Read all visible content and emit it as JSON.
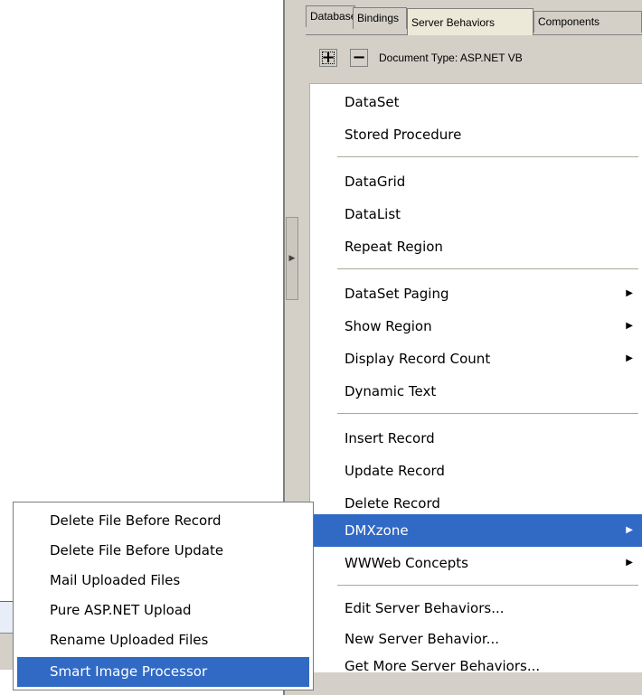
{
  "panel": {
    "tabs": [
      "Databases",
      "Bindings",
      "Server Behaviors",
      "Components"
    ],
    "active_tab": "Server Behaviors",
    "toolbar": {
      "plus_label": "+",
      "minus_label": "−",
      "document_type": "Document Type: ASP.NET VB"
    }
  },
  "menu": {
    "items": [
      {
        "label": "DataSet"
      },
      {
        "label": "Stored Procedure"
      },
      {
        "label": "DataGrid"
      },
      {
        "label": "DataList"
      },
      {
        "label": "Repeat Region"
      },
      {
        "label": "DataSet Paging",
        "submenu": true
      },
      {
        "label": "Show Region",
        "submenu": true
      },
      {
        "label": "Display Record Count",
        "submenu": true
      },
      {
        "label": "Dynamic Text"
      },
      {
        "label": "Insert Record"
      },
      {
        "label": "Update Record"
      },
      {
        "label": "Delete Record"
      },
      {
        "label": "DMXzone",
        "submenu": true,
        "selected": true
      },
      {
        "label": "WWWeb Concepts",
        "submenu": true
      },
      {
        "label": "Edit Server Behaviors..."
      },
      {
        "label": "New Server Behavior..."
      },
      {
        "label": "Get More Server Behaviors..."
      }
    ],
    "arrow_glyph": "▶"
  },
  "submenu": {
    "items": [
      {
        "label": "Delete File Before Record"
      },
      {
        "label": "Delete File Before Update"
      },
      {
        "label": "Mail Uploaded Files"
      },
      {
        "label": "Pure ASP.NET Upload"
      },
      {
        "label": "Rename Uploaded Files"
      },
      {
        "label": "Smart Image Processor",
        "selected": true
      }
    ]
  },
  "colors": {
    "selection": "#316ac5",
    "panel": "#d4d0c8"
  }
}
